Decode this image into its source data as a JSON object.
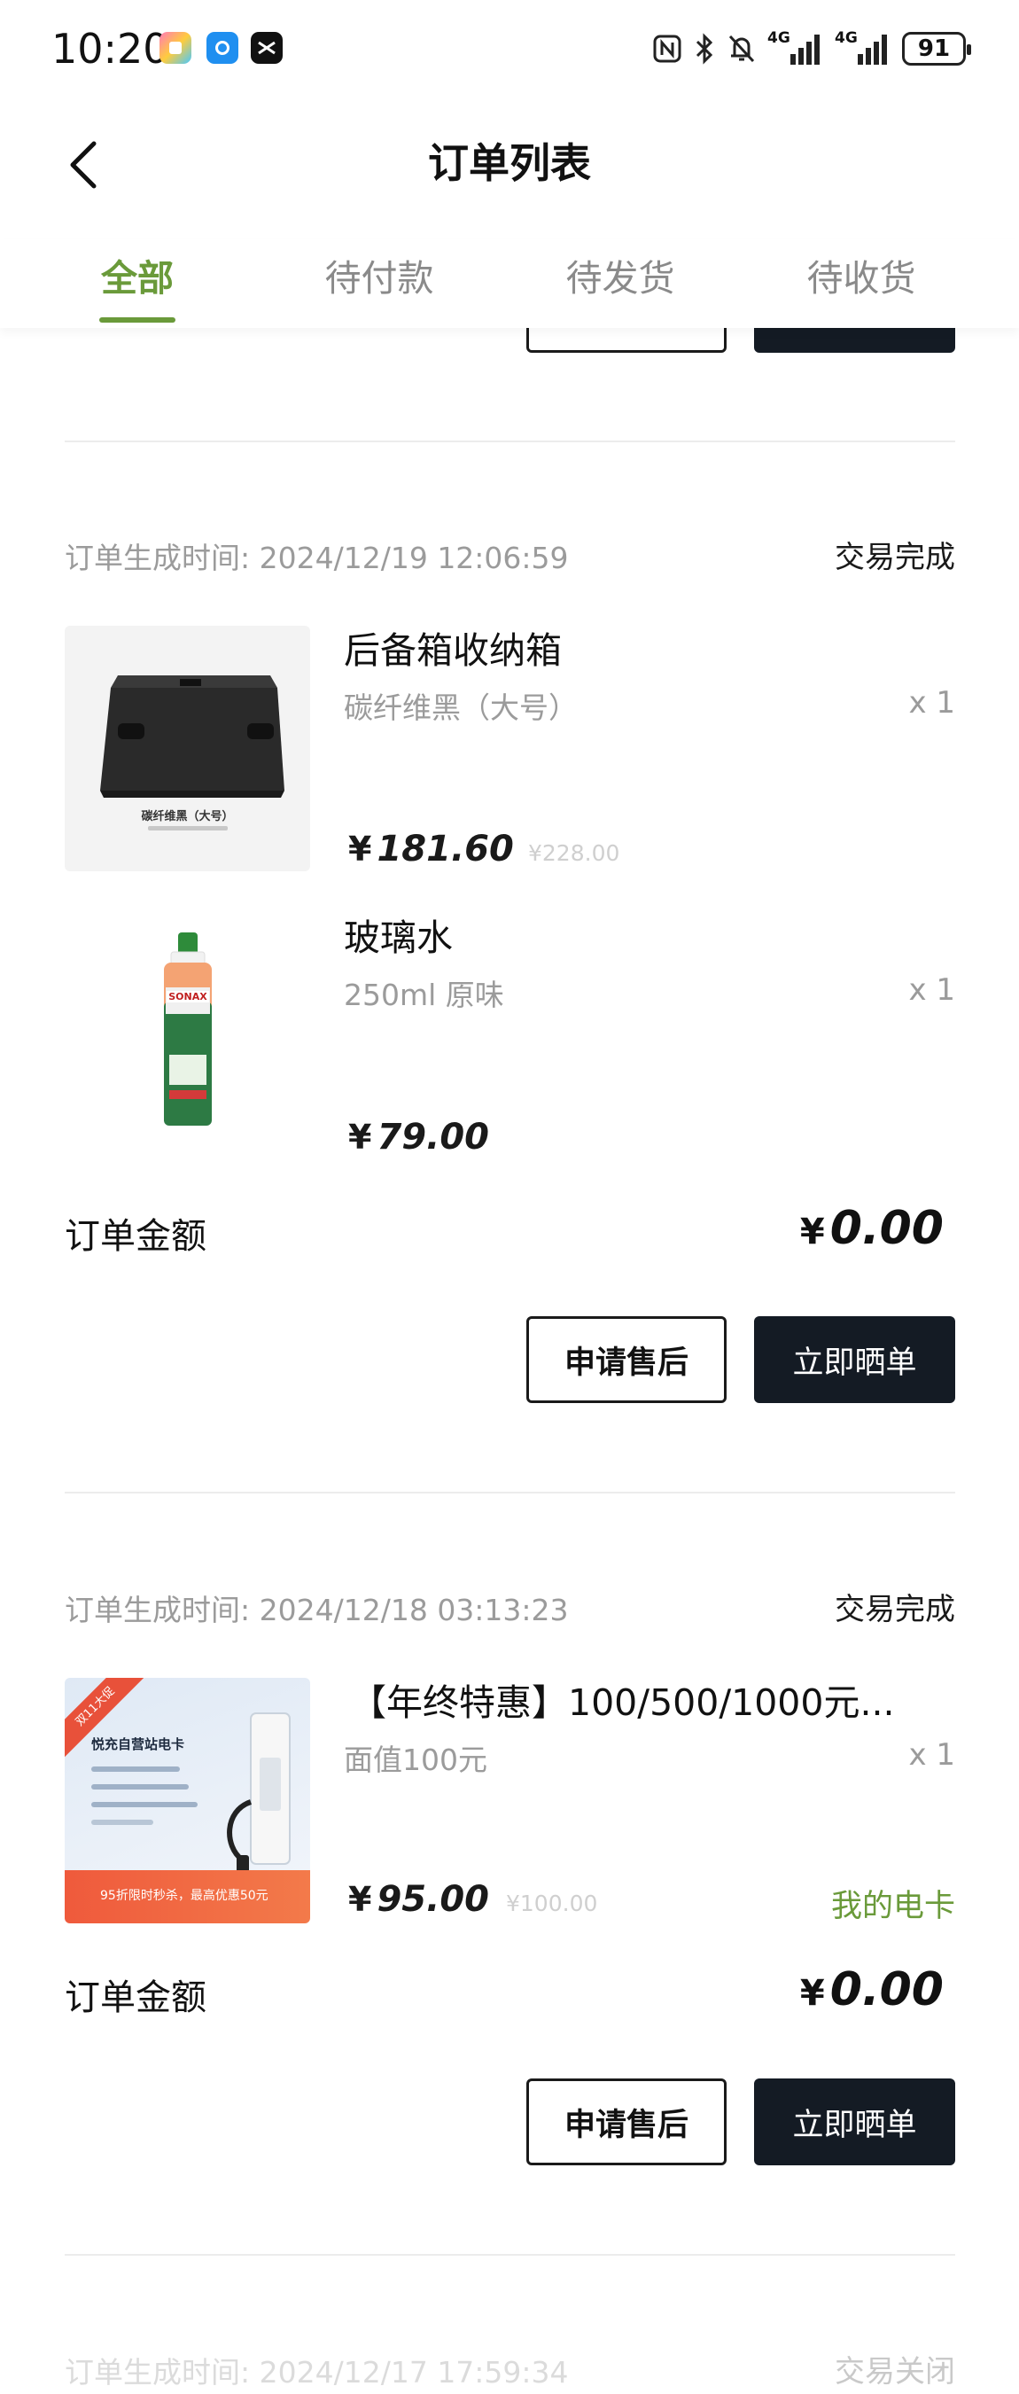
{
  "status_bar": {
    "time": "10:20",
    "network_1": "4G",
    "network_2": "4G",
    "battery": "91",
    "icons": [
      "nfc-icon",
      "bluetooth-icon",
      "mute-icon",
      "signal-icon",
      "signal-icon",
      "battery-icon"
    ]
  },
  "header": {
    "title": "订单列表",
    "back_icon": "chevron-left-icon"
  },
  "tabs": [
    {
      "label": "全部",
      "active": true
    },
    {
      "label": "待付款",
      "active": false
    },
    {
      "label": "待发货",
      "active": false
    },
    {
      "label": "待收货",
      "active": false
    }
  ],
  "orders": [
    {
      "time_label": "订单生成时间:",
      "time": "2024/12/19 12:06:59",
      "status": "交易完成",
      "items": [
        {
          "title": "后备箱收纳箱",
          "spec": "碳纤维黑（大号）",
          "qty": "x 1",
          "price": "181.60",
          "original_price": "¥228.00",
          "thumb_caption": "碳纤维黑（大号）"
        },
        {
          "title": "玻璃水",
          "spec": "250ml 原味",
          "qty": "x 1",
          "price": "79.00",
          "thumb_caption": "SONAX"
        }
      ],
      "amount_label": "订单金额",
      "amount": "0.00",
      "buttons": {
        "after_sale": "申请售后",
        "share": "立即晒单"
      }
    },
    {
      "time_label": "订单生成时间:",
      "time": "2024/12/18 03:13:23",
      "status": "交易完成",
      "items": [
        {
          "title": "【年终特惠】100/500/1000元...",
          "spec": "面值100元",
          "qty": "x 1",
          "price": "95.00",
          "original_price": "¥100.00",
          "link": "我的电卡",
          "thumb_badge": "双11大促",
          "thumb_title": "悦充自营站电卡",
          "thumb_bottom": "95折限时秒杀，最高优惠50元"
        }
      ],
      "amount_label": "订单金额",
      "amount": "0.00",
      "buttons": {
        "after_sale": "申请售后",
        "share": "立即晒单"
      }
    },
    {
      "time_label": "订单生成时间:",
      "time": "2024/12/17 17:59:34",
      "status": "交易关闭"
    }
  ],
  "currency_symbol": "¥",
  "colors": {
    "accent": "#6a9a3a",
    "dark_button": "#141b24",
    "muted_text": "#9b9b9b",
    "divider": "#ececec"
  }
}
